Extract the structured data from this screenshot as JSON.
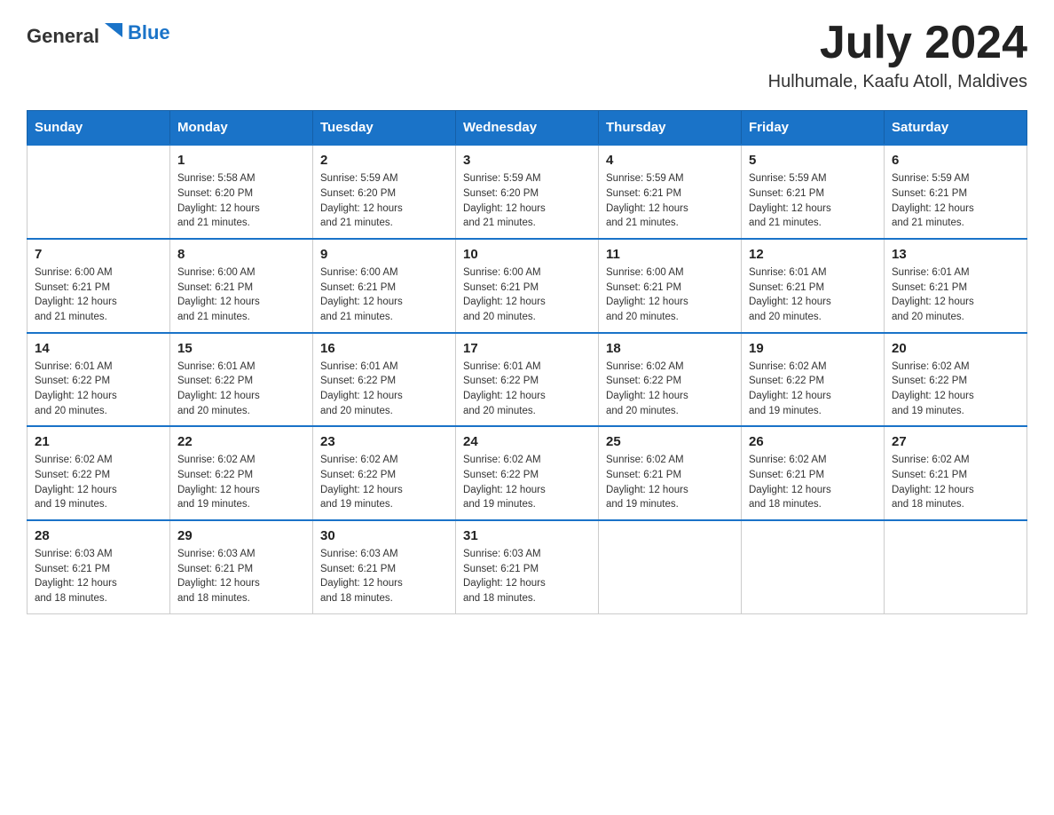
{
  "header": {
    "logo": {
      "text_general": "General",
      "text_blue": "Blue"
    },
    "month_title": "July 2024",
    "location": "Hulhumale, Kaafu Atoll, Maldives"
  },
  "days_of_week": [
    "Sunday",
    "Monday",
    "Tuesday",
    "Wednesday",
    "Thursday",
    "Friday",
    "Saturday"
  ],
  "weeks": [
    [
      {
        "day": "",
        "info": ""
      },
      {
        "day": "1",
        "info": "Sunrise: 5:58 AM\nSunset: 6:20 PM\nDaylight: 12 hours\nand 21 minutes."
      },
      {
        "day": "2",
        "info": "Sunrise: 5:59 AM\nSunset: 6:20 PM\nDaylight: 12 hours\nand 21 minutes."
      },
      {
        "day": "3",
        "info": "Sunrise: 5:59 AM\nSunset: 6:20 PM\nDaylight: 12 hours\nand 21 minutes."
      },
      {
        "day": "4",
        "info": "Sunrise: 5:59 AM\nSunset: 6:21 PM\nDaylight: 12 hours\nand 21 minutes."
      },
      {
        "day": "5",
        "info": "Sunrise: 5:59 AM\nSunset: 6:21 PM\nDaylight: 12 hours\nand 21 minutes."
      },
      {
        "day": "6",
        "info": "Sunrise: 5:59 AM\nSunset: 6:21 PM\nDaylight: 12 hours\nand 21 minutes."
      }
    ],
    [
      {
        "day": "7",
        "info": "Sunrise: 6:00 AM\nSunset: 6:21 PM\nDaylight: 12 hours\nand 21 minutes."
      },
      {
        "day": "8",
        "info": "Sunrise: 6:00 AM\nSunset: 6:21 PM\nDaylight: 12 hours\nand 21 minutes."
      },
      {
        "day": "9",
        "info": "Sunrise: 6:00 AM\nSunset: 6:21 PM\nDaylight: 12 hours\nand 21 minutes."
      },
      {
        "day": "10",
        "info": "Sunrise: 6:00 AM\nSunset: 6:21 PM\nDaylight: 12 hours\nand 20 minutes."
      },
      {
        "day": "11",
        "info": "Sunrise: 6:00 AM\nSunset: 6:21 PM\nDaylight: 12 hours\nand 20 minutes."
      },
      {
        "day": "12",
        "info": "Sunrise: 6:01 AM\nSunset: 6:21 PM\nDaylight: 12 hours\nand 20 minutes."
      },
      {
        "day": "13",
        "info": "Sunrise: 6:01 AM\nSunset: 6:21 PM\nDaylight: 12 hours\nand 20 minutes."
      }
    ],
    [
      {
        "day": "14",
        "info": "Sunrise: 6:01 AM\nSunset: 6:22 PM\nDaylight: 12 hours\nand 20 minutes."
      },
      {
        "day": "15",
        "info": "Sunrise: 6:01 AM\nSunset: 6:22 PM\nDaylight: 12 hours\nand 20 minutes."
      },
      {
        "day": "16",
        "info": "Sunrise: 6:01 AM\nSunset: 6:22 PM\nDaylight: 12 hours\nand 20 minutes."
      },
      {
        "day": "17",
        "info": "Sunrise: 6:01 AM\nSunset: 6:22 PM\nDaylight: 12 hours\nand 20 minutes."
      },
      {
        "day": "18",
        "info": "Sunrise: 6:02 AM\nSunset: 6:22 PM\nDaylight: 12 hours\nand 20 minutes."
      },
      {
        "day": "19",
        "info": "Sunrise: 6:02 AM\nSunset: 6:22 PM\nDaylight: 12 hours\nand 19 minutes."
      },
      {
        "day": "20",
        "info": "Sunrise: 6:02 AM\nSunset: 6:22 PM\nDaylight: 12 hours\nand 19 minutes."
      }
    ],
    [
      {
        "day": "21",
        "info": "Sunrise: 6:02 AM\nSunset: 6:22 PM\nDaylight: 12 hours\nand 19 minutes."
      },
      {
        "day": "22",
        "info": "Sunrise: 6:02 AM\nSunset: 6:22 PM\nDaylight: 12 hours\nand 19 minutes."
      },
      {
        "day": "23",
        "info": "Sunrise: 6:02 AM\nSunset: 6:22 PM\nDaylight: 12 hours\nand 19 minutes."
      },
      {
        "day": "24",
        "info": "Sunrise: 6:02 AM\nSunset: 6:22 PM\nDaylight: 12 hours\nand 19 minutes."
      },
      {
        "day": "25",
        "info": "Sunrise: 6:02 AM\nSunset: 6:21 PM\nDaylight: 12 hours\nand 19 minutes."
      },
      {
        "day": "26",
        "info": "Sunrise: 6:02 AM\nSunset: 6:21 PM\nDaylight: 12 hours\nand 18 minutes."
      },
      {
        "day": "27",
        "info": "Sunrise: 6:02 AM\nSunset: 6:21 PM\nDaylight: 12 hours\nand 18 minutes."
      }
    ],
    [
      {
        "day": "28",
        "info": "Sunrise: 6:03 AM\nSunset: 6:21 PM\nDaylight: 12 hours\nand 18 minutes."
      },
      {
        "day": "29",
        "info": "Sunrise: 6:03 AM\nSunset: 6:21 PM\nDaylight: 12 hours\nand 18 minutes."
      },
      {
        "day": "30",
        "info": "Sunrise: 6:03 AM\nSunset: 6:21 PM\nDaylight: 12 hours\nand 18 minutes."
      },
      {
        "day": "31",
        "info": "Sunrise: 6:03 AM\nSunset: 6:21 PM\nDaylight: 12 hours\nand 18 minutes."
      },
      {
        "day": "",
        "info": ""
      },
      {
        "day": "",
        "info": ""
      },
      {
        "day": "",
        "info": ""
      }
    ]
  ]
}
